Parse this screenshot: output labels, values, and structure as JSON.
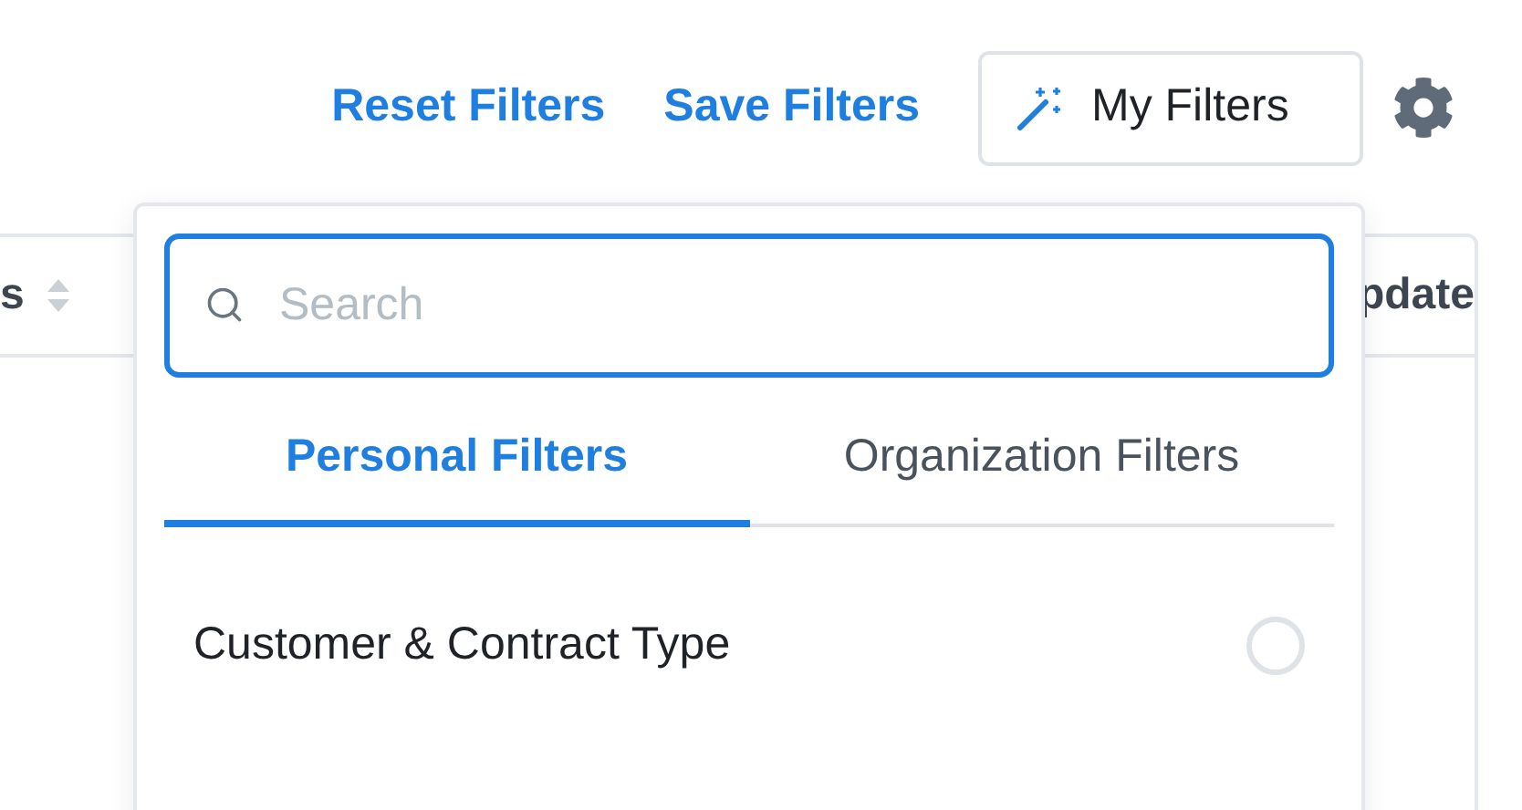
{
  "toolbar": {
    "reset_link": "Reset Filters",
    "save_link": "Save Filters",
    "my_filters_button": "My Filters"
  },
  "table": {
    "columns": [
      {
        "label": "s",
        "sortable": true
      },
      {
        "label": "pdate",
        "sortable": false
      }
    ]
  },
  "filters_dropdown": {
    "search": {
      "placeholder": "Search"
    },
    "tabs": [
      {
        "label": "Personal Filters",
        "selected": true
      },
      {
        "label": "Organization Filters",
        "selected": false
      }
    ],
    "items": [
      {
        "label": "Customer & Contract Type",
        "selected": false
      }
    ]
  }
}
